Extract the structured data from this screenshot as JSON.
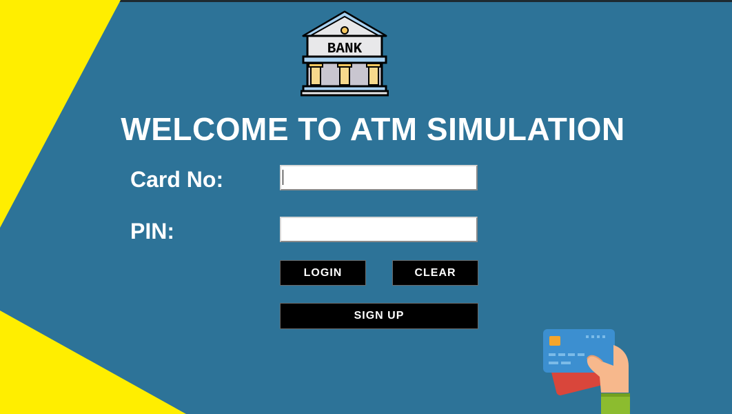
{
  "app": {
    "title": "WELCOME TO ATM SIMULATION"
  },
  "form": {
    "card_label": "Card No:",
    "card_value": "",
    "pin_label": "PIN:",
    "pin_value": ""
  },
  "buttons": {
    "login": "LOGIN",
    "clear": "CLEAR",
    "signup": "SIGN UP"
  },
  "logo": {
    "text": "BANK",
    "icon": "bank-building-icon"
  },
  "illustration": {
    "icon": "hand-holding-credit-cards-icon"
  },
  "colors": {
    "background": "#2d7398",
    "accent_yellow": "#ffee00",
    "button_bg": "#000000",
    "text": "#ffffff"
  }
}
